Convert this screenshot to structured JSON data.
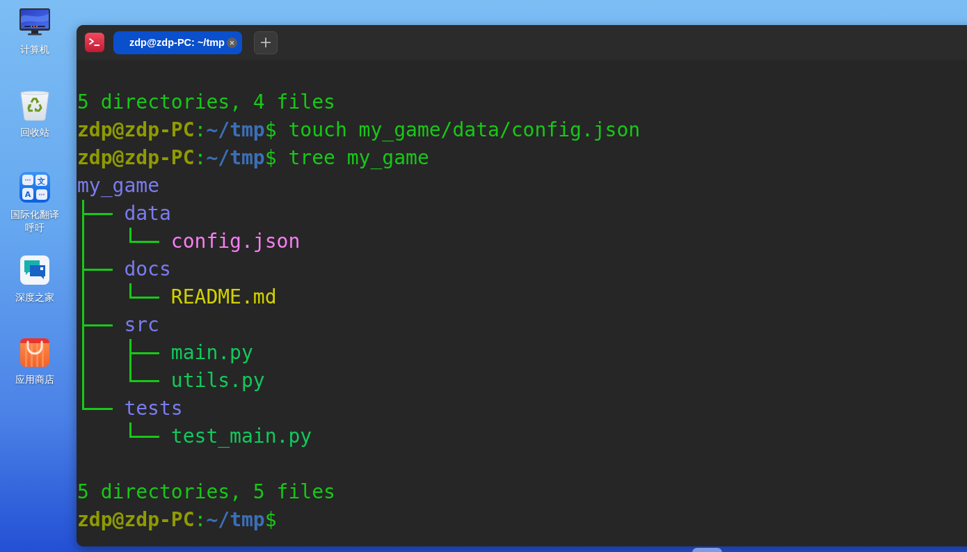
{
  "desktop_icons": [
    {
      "kind": "computer",
      "label": "计算机"
    },
    {
      "kind": "trash",
      "label": "回收站"
    },
    {
      "kind": "translate",
      "label": "国际化翻译呼吁",
      "icon_text": [
        "文",
        "A"
      ]
    },
    {
      "kind": "community",
      "label": "深度之家"
    },
    {
      "kind": "store",
      "label": "应用商店"
    }
  ],
  "title_bar": {
    "tabs": [
      {
        "label": "zdp@zdp-PC: ~/tmp",
        "selected": true
      }
    ]
  },
  "terminal": {
    "lines": [
      {
        "kind": "output",
        "text": "5 directories, 4 files"
      },
      {
        "kind": "prompt",
        "user": "zdp@zdp-PC",
        "separator": ":",
        "path": "~/tmp",
        "symbol": "$",
        "command": "touch my_game/data/config.json"
      },
      {
        "kind": "prompt",
        "user": "zdp@zdp-PC",
        "separator": ":",
        "path": "~/tmp",
        "symbol": "$",
        "command": "tree my_game"
      },
      {
        "kind": "tree",
        "root": {
          "name": "my_game",
          "color": "#7b7bf0",
          "children": [
            {
              "name": "data",
              "color": "#7b7bf0",
              "children": [
                {
                  "name": "config.json",
                  "color": "#f77ef2"
                }
              ]
            },
            {
              "name": "docs",
              "color": "#7b7bf0",
              "children": [
                {
                  "name": "README.md",
                  "color": "#d2d200"
                }
              ]
            },
            {
              "name": "src",
              "color": "#7b7bf0",
              "children": [
                {
                  "name": "main.py",
                  "color": "#12c85c"
                },
                {
                  "name": "utils.py",
                  "color": "#12c85c"
                }
              ]
            },
            {
              "name": "tests",
              "color": "#7b7bf0",
              "children": [
                {
                  "name": "test_main.py",
                  "color": "#12c85c"
                }
              ]
            }
          ]
        }
      },
      {
        "kind": "blank"
      },
      {
        "kind": "output",
        "text": "5 directories, 5 files"
      },
      {
        "kind": "prompt",
        "user": "zdp@zdp-PC",
        "separator": ":",
        "path": "~/tmp",
        "symbol": "$"
      }
    ]
  }
}
